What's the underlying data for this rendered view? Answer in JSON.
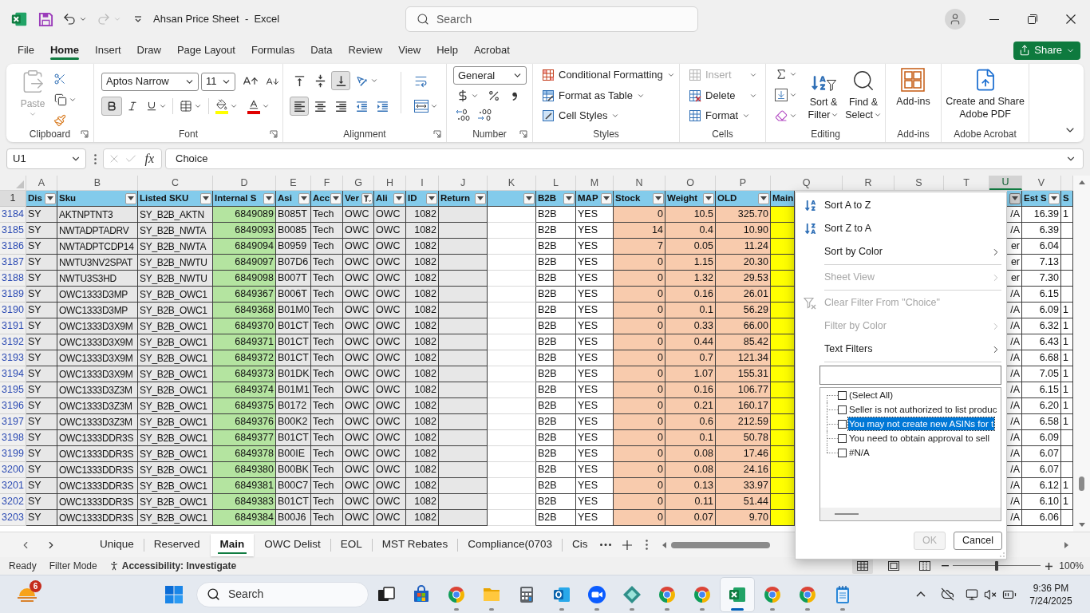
{
  "window": {
    "title": "Ahsan Price Sheet  -  Excel",
    "search": {
      "placeholder": "Search"
    },
    "undo": {
      "disabled": false
    },
    "redo": {
      "disabled": true
    }
  },
  "menu_tabs": [
    {
      "label": "File",
      "selected": false
    },
    {
      "label": "Home",
      "selected": true
    },
    {
      "label": "Insert",
      "selected": false
    },
    {
      "label": "Draw",
      "selected": false
    },
    {
      "label": "Page Layout",
      "selected": false
    },
    {
      "label": "Formulas",
      "selected": false
    },
    {
      "label": "Data",
      "selected": false
    },
    {
      "label": "Review",
      "selected": false
    },
    {
      "label": "View",
      "selected": false
    },
    {
      "label": "Help",
      "selected": false
    },
    {
      "label": "Acrobat",
      "selected": false
    }
  ],
  "share_button": "Share",
  "ribbon": {
    "clipboard": {
      "label": "Clipboard",
      "paste": {
        "label": "Paste",
        "disabled": true
      }
    },
    "font": {
      "label": "Font",
      "name": "Aptos Narrow",
      "size": "11",
      "bold": true,
      "italic": false,
      "underline": false
    },
    "alignment": {
      "label": "Alignment",
      "vertical": [
        {
          "selected": false
        },
        {
          "selected": false
        },
        {
          "selected": true
        }
      ],
      "horizontal": [
        {
          "selected": true
        },
        {
          "selected": false
        },
        {
          "selected": false
        }
      ]
    },
    "number": {
      "label": "Number",
      "format": "General"
    },
    "styles": {
      "label": "Styles",
      "items": [
        "Conditional Formatting",
        "Format as Table",
        "Cell Styles"
      ]
    },
    "cells": {
      "label": "Cells",
      "items": [
        {
          "label": "Insert",
          "disabled": true
        },
        {
          "label": "Delete",
          "disabled": false
        },
        {
          "label": "Format",
          "disabled": false
        }
      ]
    },
    "editing": {
      "label": "Editing",
      "sort_filter": [
        "Sort &",
        "Filter"
      ],
      "find_select": [
        "Find &",
        "Select"
      ]
    },
    "addins": {
      "label": "Add-ins",
      "button": "Add-ins"
    },
    "acrobat": {
      "label": "Adobe Acrobat",
      "button": [
        "Create and Share",
        "Adobe PDF"
      ]
    }
  },
  "formula_bar": {
    "name_box": "U1",
    "function_button": "fx",
    "value": "Choice",
    "editing": false
  },
  "columns": [
    {
      "letter": "A",
      "heading": "Dis",
      "filtered": false,
      "color": "#e7e7e7",
      "selected": false
    },
    {
      "letter": "B",
      "heading": "Sku",
      "filtered": false,
      "color": "#e7e7e7",
      "selected": false
    },
    {
      "letter": "C",
      "heading": "Listed SKU",
      "filtered": false,
      "color": "#e7e7e7",
      "selected": false
    },
    {
      "letter": "D",
      "heading": "Internal S",
      "filtered": false,
      "color": "#b4e4a0",
      "selected": false
    },
    {
      "letter": "E",
      "heading": "Asi",
      "filtered": false,
      "color": "#e7e7e7",
      "selected": false
    },
    {
      "letter": "F",
      "heading": "Acc",
      "filtered": false,
      "color": "#e7e7e7",
      "selected": false
    },
    {
      "letter": "G",
      "heading": "Ver",
      "filtered": true,
      "color": "#e7e7e7",
      "selected": false
    },
    {
      "letter": "H",
      "heading": "Ali",
      "filtered": false,
      "color": "#e7e7e7",
      "selected": false
    },
    {
      "letter": "I",
      "heading": "ID",
      "filtered": false,
      "color": "#e7e7e7",
      "selected": false
    },
    {
      "letter": "J",
      "heading": "Return",
      "filtered": false,
      "color": "#e7e7e7",
      "selected": false
    },
    {
      "letter": "K",
      "filtered": false,
      "color": "#ffffff",
      "selected": false
    },
    {
      "letter": "L",
      "heading": "B2B",
      "filtered": false,
      "color": "#ffffff",
      "selected": false
    },
    {
      "letter": "M",
      "heading": "MAP",
      "filtered": false,
      "color": "#ffffff",
      "selected": false
    },
    {
      "letter": "N",
      "heading": "Stock",
      "filtered": false,
      "color": "#f8cbad",
      "selected": false
    },
    {
      "letter": "O",
      "heading": "Weight",
      "filtered": false,
      "color": "#f8cbad",
      "selected": false
    },
    {
      "letter": "P",
      "heading": "OLD",
      "filtered": false,
      "color": "#f8cbad",
      "selected": false
    },
    {
      "letter": "Q",
      "heading": "Main",
      "color": "#ffff00",
      "selected": false
    },
    {
      "letter": "R",
      "selected": false
    },
    {
      "letter": "S",
      "selected": false
    },
    {
      "letter": "T",
      "selected": false
    },
    {
      "letter": "U",
      "filtered": false,
      "color": "#ffffff",
      "selected": true
    },
    {
      "letter": "V",
      "heading": "Est S",
      "filtered": false,
      "color": "#ffffff",
      "selected": false
    },
    {
      "heading": "S",
      "color": "#ffffff",
      "selected": false
    }
  ],
  "header_row_number": "1",
  "rows": [
    {
      "number": "3184",
      "cells": [
        "SY",
        "AKTNPTNT3",
        "SY_B2B_AKTN",
        "6849089",
        "B085T",
        "Tech",
        "OWC",
        "OWC",
        "1082",
        null,
        null,
        "B2B",
        "YES",
        "0",
        "10.5",
        "325.70",
        null,
        null,
        null,
        null,
        "/A",
        "16.39",
        "1"
      ]
    },
    {
      "number": "3185",
      "cells": [
        "SY",
        "NWTADPTADRV",
        "SY_B2B_NWTA",
        "6849093",
        "B0085",
        "Tech",
        "OWC",
        "OWC",
        "1082",
        null,
        null,
        "B2B",
        "YES",
        "14",
        "0.4",
        "10.90",
        null,
        null,
        null,
        null,
        "/A",
        "6.39",
        null
      ]
    },
    {
      "number": "3186",
      "cells": [
        "SY",
        "NWTADPTCDP14",
        "SY_B2B_NWTA",
        "6849094",
        "B0959",
        "Tech",
        "OWC",
        "OWC",
        "1082",
        null,
        null,
        "B2B",
        "YES",
        "7",
        "0.05",
        "11.24",
        null,
        null,
        null,
        null,
        "er",
        "6.04",
        null
      ]
    },
    {
      "number": "3187",
      "cells": [
        "SY",
        "NWTU3NV2SPAT",
        "SY_B2B_NWTU",
        "6849097",
        "B07D6",
        "Tech",
        "OWC",
        "OWC",
        "1082",
        null,
        null,
        "B2B",
        "YES",
        "0",
        "1.15",
        "20.30",
        null,
        null,
        null,
        null,
        "er",
        "7.13",
        null
      ]
    },
    {
      "number": "3188",
      "cells": [
        "SY",
        "NWTU3S3HD",
        "SY_B2B_NWTU",
        "6849098",
        "B007T",
        "Tech",
        "OWC",
        "OWC",
        "1082",
        null,
        null,
        "B2B",
        "YES",
        "0",
        "1.32",
        "29.53",
        null,
        null,
        null,
        null,
        "er",
        "7.30",
        null
      ]
    },
    {
      "number": "3189",
      "cells": [
        "SY",
        "OWC1333D3MP",
        "SY_B2B_OWC1",
        "6849367",
        "B006T",
        "Tech",
        "OWC",
        "OWC",
        "1082",
        null,
        null,
        "B2B",
        "YES",
        "0",
        "0.16",
        "26.01",
        null,
        null,
        null,
        null,
        "/A",
        "6.15",
        null
      ]
    },
    {
      "number": "3190",
      "cells": [
        "SY",
        "OWC1333D3MP",
        "SY_B2B_OWC1",
        "6849368",
        "B01M0",
        "Tech",
        "OWC",
        "OWC",
        "1082",
        null,
        null,
        "B2B",
        "YES",
        "0",
        "0.1",
        "56.29",
        null,
        null,
        null,
        null,
        "/A",
        "6.09",
        "1"
      ]
    },
    {
      "number": "3191",
      "cells": [
        "SY",
        "OWC1333D3X9M",
        "SY_B2B_OWC1",
        "6849370",
        "B01CT",
        "Tech",
        "OWC",
        "OWC",
        "1082",
        null,
        null,
        "B2B",
        "YES",
        "0",
        "0.33",
        "66.00",
        null,
        null,
        null,
        null,
        "/A",
        "6.32",
        "1"
      ]
    },
    {
      "number": "3192",
      "cells": [
        "SY",
        "OWC1333D3X9M",
        "SY_B2B_OWC1",
        "6849371",
        "B01CT",
        "Tech",
        "OWC",
        "OWC",
        "1082",
        null,
        null,
        "B2B",
        "YES",
        "0",
        "0.44",
        "85.42",
        null,
        null,
        null,
        null,
        "/A",
        "6.43",
        "1"
      ]
    },
    {
      "number": "3193",
      "cells": [
        "SY",
        "OWC1333D3X9M",
        "SY_B2B_OWC1",
        "6849372",
        "B01CT",
        "Tech",
        "OWC",
        "OWC",
        "1082",
        null,
        null,
        "B2B",
        "YES",
        "0",
        "0.7",
        "121.34",
        null,
        null,
        null,
        null,
        "/A",
        "6.68",
        "1"
      ]
    },
    {
      "number": "3194",
      "cells": [
        "SY",
        "OWC1333D3X9M",
        "SY_B2B_OWC1",
        "6849373",
        "B01DK",
        "Tech",
        "OWC",
        "OWC",
        "1082",
        null,
        null,
        "B2B",
        "YES",
        "0",
        "1.07",
        "155.31",
        null,
        null,
        null,
        null,
        "/A",
        "7.05",
        "1"
      ]
    },
    {
      "number": "3195",
      "cells": [
        "SY",
        "OWC1333D3Z3M",
        "SY_B2B_OWC1",
        "6849374",
        "B01M1",
        "Tech",
        "OWC",
        "OWC",
        "1082",
        null,
        null,
        "B2B",
        "YES",
        "0",
        "0.16",
        "106.77",
        null,
        null,
        null,
        null,
        "/A",
        "6.15",
        "1"
      ]
    },
    {
      "number": "3196",
      "cells": [
        "SY",
        "OWC1333D3Z3M",
        "SY_B2B_OWC1",
        "6849375",
        "B0172",
        "Tech",
        "OWC",
        "OWC",
        "1082",
        null,
        null,
        "B2B",
        "YES",
        "0",
        "0.21",
        "160.17",
        null,
        null,
        null,
        null,
        "/A",
        "6.20",
        "1"
      ]
    },
    {
      "number": "3197",
      "cells": [
        "SY",
        "OWC1333D3Z3M",
        "SY_B2B_OWC1",
        "6849376",
        "B00K2",
        "Tech",
        "OWC",
        "OWC",
        "1082",
        null,
        null,
        "B2B",
        "YES",
        "0",
        "0.6",
        "212.59",
        null,
        null,
        null,
        null,
        "/A",
        "6.58",
        "1"
      ]
    },
    {
      "number": "3198",
      "cells": [
        "SY",
        "OWC1333DDR3S",
        "SY_B2B_OWC1",
        "6849377",
        "B01CT",
        "Tech",
        "OWC",
        "OWC",
        "1082",
        null,
        null,
        "B2B",
        "YES",
        "0",
        "0.1",
        "50.78",
        null,
        null,
        null,
        null,
        "/A",
        "6.09",
        null
      ]
    },
    {
      "number": "3199",
      "cells": [
        "SY",
        "OWC1333DDR3S",
        "SY_B2B_OWC1",
        "6849378",
        "B00IE",
        "Tech",
        "OWC",
        "OWC",
        "1082",
        null,
        null,
        "B2B",
        "YES",
        "0",
        "0.08",
        "17.46",
        null,
        null,
        null,
        null,
        "/A",
        "6.07",
        null
      ]
    },
    {
      "number": "3200",
      "cells": [
        "SY",
        "OWC1333DDR3S",
        "SY_B2B_OWC1",
        "6849380",
        "B00BK",
        "Tech",
        "OWC",
        "OWC",
        "1082",
        null,
        null,
        "B2B",
        "YES",
        "0",
        "0.08",
        "24.16",
        null,
        null,
        null,
        null,
        "/A",
        "6.07",
        null
      ]
    },
    {
      "number": "3201",
      "cells": [
        "SY",
        "OWC1333DDR3S",
        "SY_B2B_OWC1",
        "6849381",
        "B00C7",
        "Tech",
        "OWC",
        "OWC",
        "1082",
        null,
        null,
        "B2B",
        "YES",
        "0",
        "0.13",
        "33.97",
        null,
        null,
        null,
        null,
        "/A",
        "6.12",
        "1"
      ]
    },
    {
      "number": "3202",
      "cells": [
        "SY",
        "OWC1333DDR3S",
        "SY_B2B_OWC1",
        "6849383",
        "B01CT",
        "Tech",
        "OWC",
        "OWC",
        "1082",
        null,
        null,
        "B2B",
        "YES",
        "0",
        "0.11",
        "51.44",
        null,
        null,
        null,
        null,
        "/A",
        "6.10",
        "1"
      ]
    },
    {
      "number": "3203",
      "cells": [
        "SY",
        "OWC1333DDR3S",
        "SY_B2B_OWC1",
        "6849384",
        "B00J6",
        "Tech",
        "OWC",
        "OWC",
        "1082",
        null,
        null,
        "B2B",
        "YES",
        "0",
        "0.07",
        "9.70",
        null,
        null,
        null,
        null,
        "/A",
        "6.06",
        null
      ]
    }
  ],
  "sheet_tabs": [
    {
      "label": "Unique",
      "selected": false
    },
    {
      "label": "Reserved",
      "selected": false
    },
    {
      "label": "Main",
      "selected": true
    },
    {
      "label": "OWC Delist",
      "selected": false
    },
    {
      "label": "EOL",
      "selected": false
    },
    {
      "label": "MST Rebates",
      "selected": false
    },
    {
      "label": "Compliance(0703",
      "selected": false
    },
    {
      "label": "Cis",
      "selected": false
    }
  ],
  "status_bar": {
    "ready": "Ready",
    "mode": "Filter Mode",
    "accessibility": "Accessibility: Investigate",
    "views": [
      {
        "selected": true
      },
      {
        "selected": false
      },
      {
        "selected": false
      }
    ],
    "zoom": {
      "level": 0.5,
      "reading": "100%"
    }
  },
  "filter_menu": {
    "groups": [
      [
        {
          "label": "Sort A to Z",
          "disabled": false,
          "submenu": false
        },
        {
          "label": "Sort Z to A",
          "disabled": false,
          "submenu": false
        },
        {
          "label": "Sort by Color",
          "disabled": false,
          "submenu": true
        }
      ],
      [
        {
          "label": "Sheet View",
          "disabled": true,
          "submenu": true
        }
      ],
      [
        {
          "label": "Clear Filter From \"Choice\"",
          "disabled": true,
          "submenu": false
        },
        {
          "label": "Filter by Color",
          "disabled": true,
          "submenu": true
        },
        {
          "label": "Text Filters",
          "disabled": false,
          "submenu": true
        }
      ]
    ],
    "values": [
      {
        "label": "(Select All)",
        "checked": false,
        "selected": false
      },
      {
        "label": "Seller is not authorized to list produc",
        "checked": false,
        "selected": false
      },
      {
        "label": "You may not create new ASINs for t",
        "checked": false,
        "selected": true
      },
      {
        "label": "You need to obtain approval to sell",
        "checked": false,
        "selected": false
      },
      {
        "label": "#N/A",
        "checked": false,
        "selected": false
      }
    ],
    "buttons": [
      {
        "label": "OK",
        "disabled": true
      },
      {
        "label": "Cancel",
        "disabled": false
      }
    ]
  },
  "taskbar": {
    "badge": "6",
    "search": {
      "placeholder": "Search"
    },
    "apps": [
      {
        "running": false,
        "selected": false
      },
      {
        "running": false,
        "selected": false
      },
      {
        "running": true,
        "selected": false
      },
      {
        "running": true,
        "selected": false
      },
      {
        "running": false,
        "selected": false
      },
      {
        "running": true,
        "selected": false
      },
      {
        "running": true,
        "selected": false
      },
      {
        "running": true,
        "selected": false
      },
      {
        "running": true,
        "selected": false
      },
      {
        "running": true,
        "selected": false
      },
      {
        "running": true,
        "selected": true
      },
      {
        "running": true,
        "selected": false
      },
      {
        "running": true,
        "selected": false
      },
      {
        "running": true,
        "selected": false
      }
    ],
    "time": "9:36 PM",
    "date": "7/24/2025"
  }
}
